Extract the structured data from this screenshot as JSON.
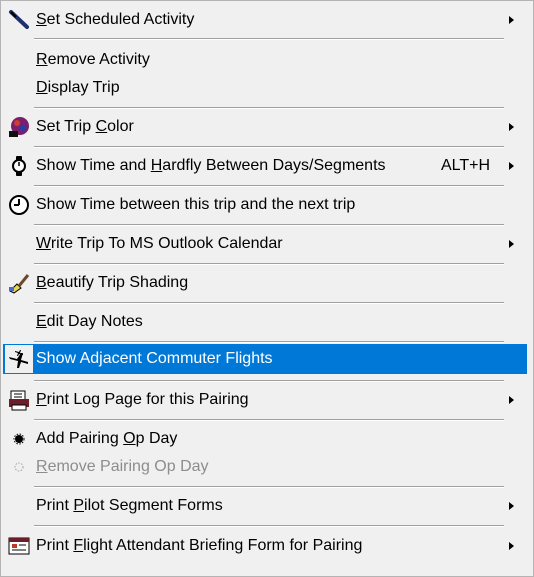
{
  "menu": {
    "items": [
      {
        "pre": "",
        "u": "S",
        "post": "et Scheduled Activity",
        "submenu": true,
        "icon": "pen-icon"
      },
      {
        "pre": "",
        "u": "R",
        "post": "emove Activity"
      },
      {
        "pre": "",
        "u": "D",
        "post": "isplay Trip"
      },
      {
        "pre": "Set Trip ",
        "u": "C",
        "post": "olor",
        "submenu": true,
        "icon": "palette-icon"
      },
      {
        "pre": "Show Time and ",
        "u": "H",
        "post": "ardfly Between Days/Segments",
        "shortcut": "ALT+H",
        "submenu": true,
        "icon": "watch-icon"
      },
      {
        "pre": "Show Time between this trip and the next trip",
        "u": "",
        "post": "",
        "icon": "clock-icon"
      },
      {
        "pre": "",
        "u": "W",
        "post": "rite Trip To MS Outlook Calendar",
        "submenu": true
      },
      {
        "pre": "",
        "u": "B",
        "post": "eautify Trip Shading",
        "icon": "brush-icon"
      },
      {
        "pre": "",
        "u": "E",
        "post": "dit Day Notes"
      },
      {
        "pre": "Show Adjacent Commuter Flights",
        "u": "",
        "post": "",
        "icon": "airplanes-icon",
        "selected": true
      },
      {
        "pre": "",
        "u": "P",
        "post": "rint Log Page for this Pairing",
        "submenu": true,
        "icon": "printer-log-icon"
      },
      {
        "pre": "Add Pairing ",
        "u": "O",
        "post": "p Day",
        "icon": "radio-dot-icon"
      },
      {
        "pre": "",
        "u": "R",
        "post": "emove Pairing Op Day",
        "icon": "radio-dot-disabled-icon",
        "disabled": true
      },
      {
        "pre": "Print ",
        "u": "P",
        "post": "ilot Segment Forms",
        "submenu": true
      },
      {
        "pre": "Print ",
        "u": "F",
        "post": "light Attendant Briefing Form for Pairing",
        "submenu": true,
        "icon": "briefing-form-icon"
      }
    ],
    "colors": {
      "selected_bg": "#0078d7",
      "menu_bg": "#f0f0f0",
      "disabled_text": "#8d8d8d"
    }
  }
}
